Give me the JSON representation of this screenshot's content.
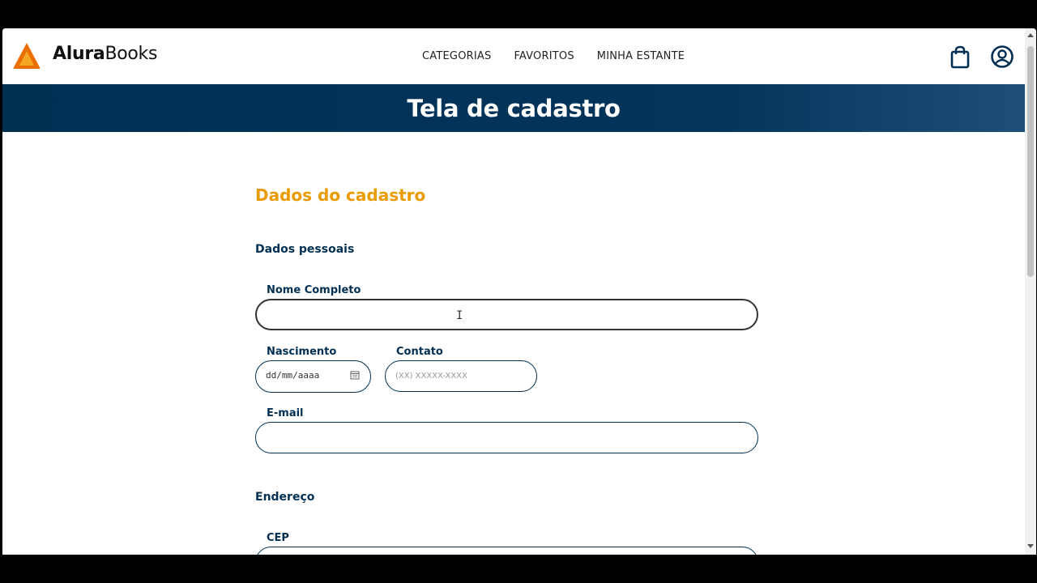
{
  "header": {
    "brand_bold": "Alura",
    "brand_light": "Books",
    "nav": [
      "CATEGORIAS",
      "FAVORITOS",
      "MINHA ESTANTE"
    ],
    "icons": [
      "shopping-bag-icon",
      "user-account-icon"
    ]
  },
  "banner": {
    "title": "Tela de cadastro"
  },
  "form": {
    "title": "Dados do cadastro",
    "personal_section": "Dados pessoais",
    "fields": {
      "nome": {
        "label": "Nome Completo",
        "value": ""
      },
      "nascimento": {
        "label": "Nascimento",
        "placeholder": "dd/mm/aaaa"
      },
      "contato": {
        "label": "Contato",
        "placeholder": "(XX) XXXXX-XXXX"
      },
      "email": {
        "label": "E-mail",
        "value": ""
      }
    },
    "address_section": "Endereço",
    "cep": {
      "label": "CEP"
    }
  },
  "colors": {
    "primary": "#002f52",
    "accent": "#eb9b00",
    "logo": "#eb6e00"
  }
}
